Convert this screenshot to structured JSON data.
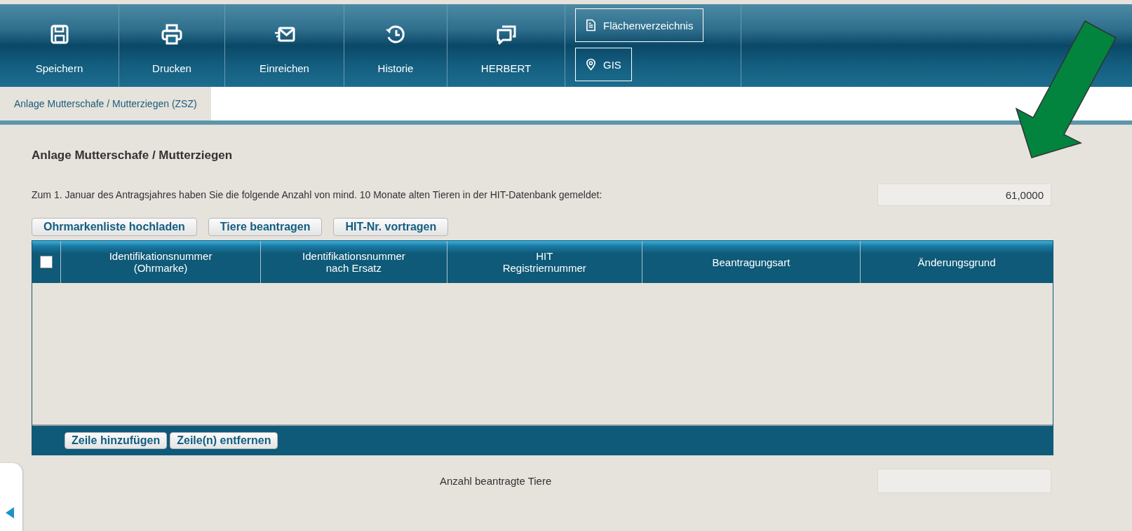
{
  "toolbar": {
    "buttons": [
      {
        "label": "Speichern"
      },
      {
        "label": "Drucken"
      },
      {
        "label": "Einreichen"
      },
      {
        "label": "Historie"
      },
      {
        "label": "HERBERT"
      }
    ],
    "links": [
      {
        "label": "Flächenverzeichnis"
      },
      {
        "label": "GIS"
      }
    ]
  },
  "tabs": [
    {
      "label": "Anlage Mutterschafe / Mutterziegen (ZSZ)",
      "selected": true
    }
  ],
  "section": {
    "title": "Anlage Mutterschafe / Mutterziegen",
    "reported_label": "Zum 1. Januar des Antragsjahres haben Sie die folgende Anzahl von mind. 10 Monate alten Tieren in der HIT-Datenbank gemeldet:",
    "reported_value": "61,0000",
    "actions": [
      "Ohrmarkenliste hochladen",
      "Tiere beantragen",
      "HIT-Nr. vortragen"
    ]
  },
  "table": {
    "select_all_checked": false,
    "columns": [
      [
        "Identifikationsnummer",
        "(Ohrmarke)"
      ],
      [
        "Identifikationsnummer",
        "nach Ersatz"
      ],
      [
        "HIT",
        "Registriernummer"
      ],
      [
        "Beantragungsart"
      ],
      [
        "Änderungsgrund"
      ]
    ],
    "footer_buttons": [
      "Zeile hinzufügen",
      "Zeile(n) entfernen"
    ]
  },
  "total": {
    "label": "Anzahl beantragte Tiere"
  },
  "annotation": {
    "kind": "arrow",
    "color": "#02843f"
  }
}
